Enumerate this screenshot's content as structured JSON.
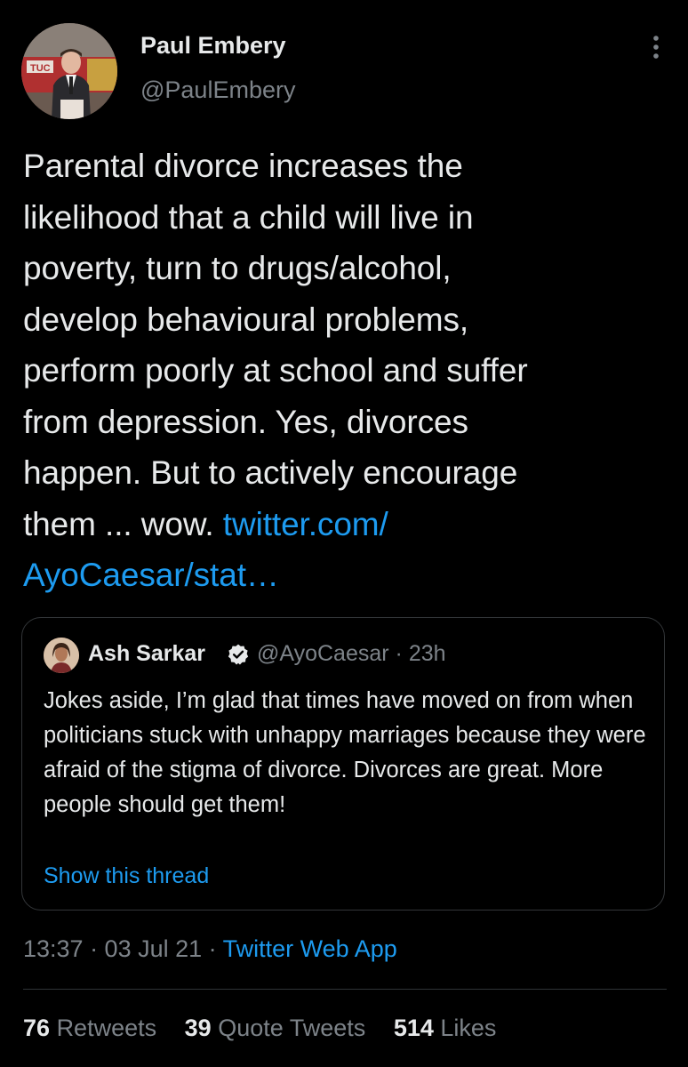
{
  "author": {
    "display_name": "Paul Embery",
    "handle": "@PaulEmbery",
    "avatar_banner_text": "TUC"
  },
  "tweet": {
    "lines": [
      "Parental divorce increases the",
      "likelihood that a child will live in",
      "poverty, turn to drugs/alcohol,",
      "develop behavioural problems,",
      "perform poorly at school and suffer",
      "from depression. Yes, divorces",
      "happen. But to actively encourage"
    ],
    "last_line_text": "them ... wow. ",
    "link_part1": "twitter.com/",
    "link_part2": "AyoCaesar/stat…"
  },
  "quoted": {
    "display_name": "Ash Sarkar",
    "handle_time": "@AyoCaesar · 23h",
    "text": "Jokes aside, I’m glad that times have moved on from when politicians stuck with unhappy marriages because they were afraid of the stigma of divorce. Divorces are great. More people should get them!",
    "show_thread": "Show this thread"
  },
  "meta": {
    "time_date": "13:37 · 03 Jul 21 · ",
    "app": "Twitter Web App"
  },
  "stats": {
    "retweets_count": "76",
    "retweets_label": "Retweets",
    "quotes_count": "39",
    "quotes_label": "Quote Tweets",
    "likes_count": "514",
    "likes_label": "Likes"
  },
  "colors": {
    "background": "#000000",
    "text": "#e7e9ea",
    "secondary": "#7d8389",
    "link": "#1d9bf0",
    "border": "#333639"
  }
}
